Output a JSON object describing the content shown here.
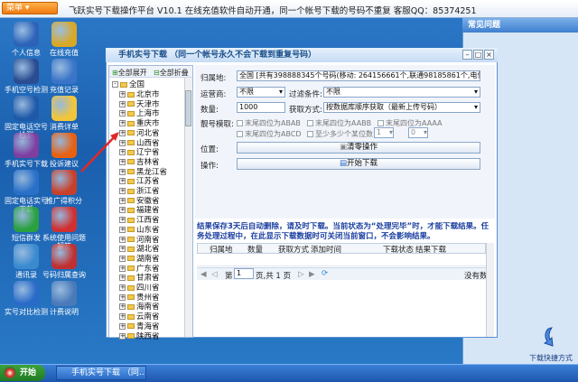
{
  "topbar": {
    "menu_label": "菜单 ▾",
    "title": "飞跃实号下载操作平台  V10.1    在线充值软件自动开通，同一个帐号下载的号码不重复   客服QQ：85374251"
  },
  "desktop_icons": [
    {
      "label": "个人信息",
      "color": "#2c62b8"
    },
    {
      "label": "在线充值",
      "color": "#d9a826"
    },
    {
      "label": "手机空号检测",
      "color": "#2a4c90"
    },
    {
      "label": "充值记录",
      "color": "#3a74c8"
    },
    {
      "label": "固定电话空号检测",
      "color": "#1f5aa8"
    },
    {
      "label": "消费详单",
      "color": "#f2c63a"
    },
    {
      "label": "手机实号下载",
      "color": "#7d3fa0"
    },
    {
      "label": "投诉建议",
      "color": "#e86010"
    },
    {
      "label": "固定电话实号下载",
      "color": "#2a70c8"
    },
    {
      "label": "推广得积分",
      "color": "#c8402a"
    },
    {
      "label": "短信群发",
      "color": "#2aa040"
    },
    {
      "label": "系统使用问题解答",
      "color": "#d03030"
    },
    {
      "label": "通讯录",
      "color": "#3a8ad0"
    },
    {
      "label": "号码归属查询",
      "color": "#c03030"
    },
    {
      "label": "实号对比检测",
      "color": "#2a6ac8"
    },
    {
      "label": "计费说明",
      "color": "#4a7ab8"
    }
  ],
  "right_panel": {
    "title": "常见问题",
    "bottom_label": "下载快捷方式"
  },
  "taskbar": {
    "start_label": "开始",
    "task_label": "手机实号下载  （同…"
  },
  "window": {
    "title": "手机实号下载  （同一个帐号永久不会下载到重复号码）",
    "min": "–",
    "max": "□",
    "close": "×",
    "tree_toolbar": {
      "expand_all": "全部展开",
      "collapse_all": "全部折叠"
    },
    "tree_root": "全国",
    "tree_items": [
      "北京市",
      "天津市",
      "上海市",
      "重庆市",
      "河北省",
      "山西省",
      "辽宁省",
      "吉林省",
      "黑龙江省",
      "江苏省",
      "浙江省",
      "安徽省",
      "福建省",
      "江西省",
      "山东省",
      "河南省",
      "湖北省",
      "湖南省",
      "广东省",
      "甘肃省",
      "四川省",
      "贵州省",
      "海南省",
      "云南省",
      "青海省",
      "陕西省"
    ],
    "form": {
      "region_label": "归属地:",
      "region_value": "全国 [共有398888345个号码(移动: 264156661个,联通98185861个,电信36475",
      "operator_label": "运营商:",
      "operator_value": "不限",
      "filter_label": "过滤条件:",
      "filter_value": "不限",
      "qty_label": "数量:",
      "qty_value": "1000",
      "method_label": "获取方式:",
      "method_value": "按数据库顺序获取（最新上传号码）",
      "account_label": "靓号模取:",
      "opt1": "末尾四位为ABAB",
      "opt2": "末尾四位为AABB",
      "opt3": "末尾四位为AAAA",
      "opt4": "末尾四位为ABCD",
      "opt5": "至少多少个某位数",
      "spin1": "1",
      "spin2": "0",
      "position_label": "位置:",
      "clear_button": "清零操作",
      "action_label": "操作:",
      "start_button": "开始下载"
    },
    "notice": "结果保存3天后自动删除，请及时下载。当前状态为“处理完毕”时，才能下载结果。任务处理过程中，在此显示下载数据时可关闭当前窗口，不会影响结果。",
    "grid_headers": [
      "归属地",
      "数量",
      "获取方式",
      "添加时间",
      "下载状态",
      "结果下载"
    ],
    "pager": {
      "page_prefix": "第",
      "page_value": "1",
      "page_suffix": "页,共 1 页",
      "no_data": "没有数"
    }
  }
}
